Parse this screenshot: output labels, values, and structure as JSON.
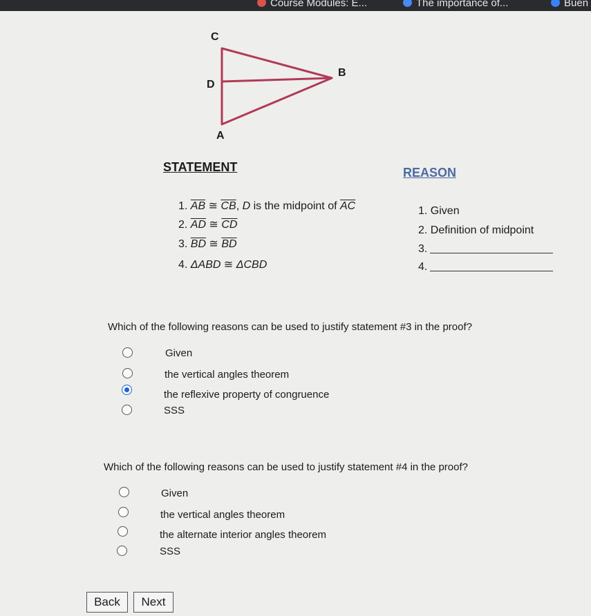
{
  "browser": {
    "tabs": [
      {
        "label": "Course Modules: E...",
        "icon": "browser-tab-icon",
        "color": "#d9534f"
      },
      {
        "label": "The importance of...",
        "icon": "google-icon",
        "color": "#4a8af4"
      },
      {
        "label": "Buen",
        "icon": "site-icon",
        "color": "#3b82f6"
      }
    ]
  },
  "diagram": {
    "vertices": {
      "c": "C",
      "d": "D",
      "b": "B",
      "a": "A"
    },
    "line_color": "#b03a56"
  },
  "proof": {
    "statement_heading": "STATEMENT",
    "reason_heading": "REASON",
    "statements": [
      {
        "num": "1.",
        "seg1": "AB",
        "rel": "≅",
        "seg2": "CB",
        "tail_a": ", ",
        "tail_var": "D",
        "tail_b": " is the midpoint of ",
        "seg3": "AC"
      },
      {
        "num": "2.",
        "seg1": "AD",
        "rel": "≅",
        "seg2": "CD"
      },
      {
        "num": "3.",
        "seg1": "BD",
        "rel": "≅",
        "seg2": "BD"
      },
      {
        "num": "4.",
        "tri1": "ΔABD",
        "rel": "≅",
        "tri2": "ΔCBD"
      }
    ],
    "reasons": [
      {
        "num": "1.",
        "text": "Given"
      },
      {
        "num": "2.",
        "text": "Definition of midpoint"
      },
      {
        "num": "3.",
        "text": ""
      },
      {
        "num": "4.",
        "text": ""
      }
    ]
  },
  "questions": [
    {
      "prompt": "Which of the following reasons can be used to justify statement #3 in the proof?",
      "options": [
        "Given",
        "the vertical angles theorem",
        "the reflexive property of congruence",
        "SSS"
      ],
      "selected": 2
    },
    {
      "prompt": "Which of the following reasons can be used to justify statement #4 in the proof?",
      "options": [
        "Given",
        "the vertical angles theorem",
        "the alternate interior angles theorem",
        "SSS"
      ],
      "selected": null
    }
  ],
  "nav": {
    "back_label": "Back",
    "next_label": "Next"
  }
}
